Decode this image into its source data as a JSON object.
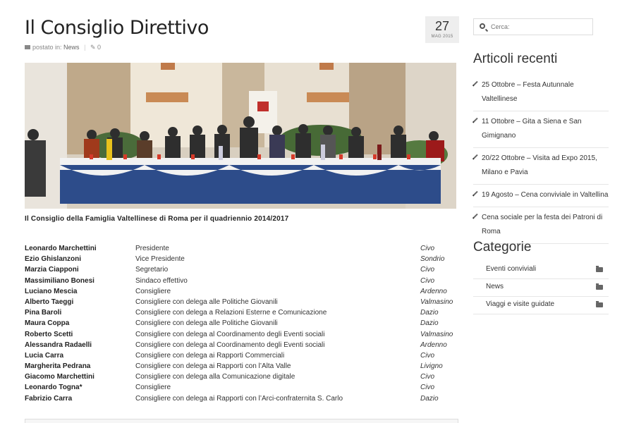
{
  "post": {
    "title": "Il Consiglio Direttivo",
    "meta_posted_in": "postato in:",
    "meta_category": "News",
    "meta_separator": "|",
    "meta_comments": "0",
    "date_day": "27",
    "date_month": "MAG 2015",
    "caption": "Il Consiglio della Famiglia Valtellinese di Roma per il quadriennio 2014/2017"
  },
  "council": [
    {
      "name": "Leonardo Marchettini",
      "role": "Presidente",
      "city": "Civo"
    },
    {
      "name": "Ezio Ghislanzoni",
      "role": "Vice Presidente",
      "city": "Sondrio"
    },
    {
      "name": "Marzia Ciapponi",
      "role": "Segretario",
      "city": "Civo"
    },
    {
      "name": "Massimiliano Bonesi",
      "role": "Sindaco effettivo",
      "city": "Civo"
    },
    {
      "name": "Luciano Mescia",
      "role": "Consigliere",
      "city": "Ardenno"
    },
    {
      "name": "Alberto Taeggi",
      "role": "Consigliere con delega alle Politiche Giovanili",
      "city": "Valmasino"
    },
    {
      "name": "Pina Baroli",
      "role": "Consigliere con delega a Relazioni Esterne e Comunicazione",
      "city": "Dazio"
    },
    {
      "name": "Maura Coppa",
      "role": "Consigliere con delega alle Politiche Giovanili",
      "city": "Dazio"
    },
    {
      "name": "Roberto Scetti",
      "role": "Consigliere con delega al Coordinamento degli Eventi sociali",
      "city": "Valmasino"
    },
    {
      "name": "Alessandra Radaelli",
      "role": "Consigliere con delega al Coordinamento degli Eventi sociali",
      "city": "Ardenno"
    },
    {
      "name": "Lucia Carra",
      "role": "Consigliere con delega ai Rapporti Commerciali",
      "city": "Civo"
    },
    {
      "name": "Margherita Pedrana",
      "role": "Consigliere con delega ai Rapporti con l’Alta Valle",
      "city": "Livigno"
    },
    {
      "name": "Giacomo Marchettini",
      "role": "Consigliere con delega alla Comunicazione digitale",
      "city": "Civo"
    },
    {
      "name": "Leonardo Togna*",
      "role": "Consigliere",
      "city": " Civo"
    },
    {
      "name": "Fabrizio Carra",
      "role": "Consigliere con delega ai Rapporti con l’Arci-confraternita S. Carlo",
      "city": "Dazio"
    }
  ],
  "sidebar": {
    "search_placeholder": "Cerca:",
    "recent_title": "Articoli recenti",
    "recent": [
      "25 Ottobre – Festa Autunnale Valtellinese",
      "11 Ottobre – Gita a Siena e San Gimignano",
      "20/22 Ottobre – Visita ad Expo 2015, Milano e Pavia",
      "19 Agosto – Cena conviviale in Valtellina",
      "Cena sociale per la festa dei Patroni di Roma"
    ],
    "categories_title": "Categorie",
    "categories": [
      "Eventi conviviali",
      "News",
      "Viaggi e visite guidate"
    ]
  }
}
